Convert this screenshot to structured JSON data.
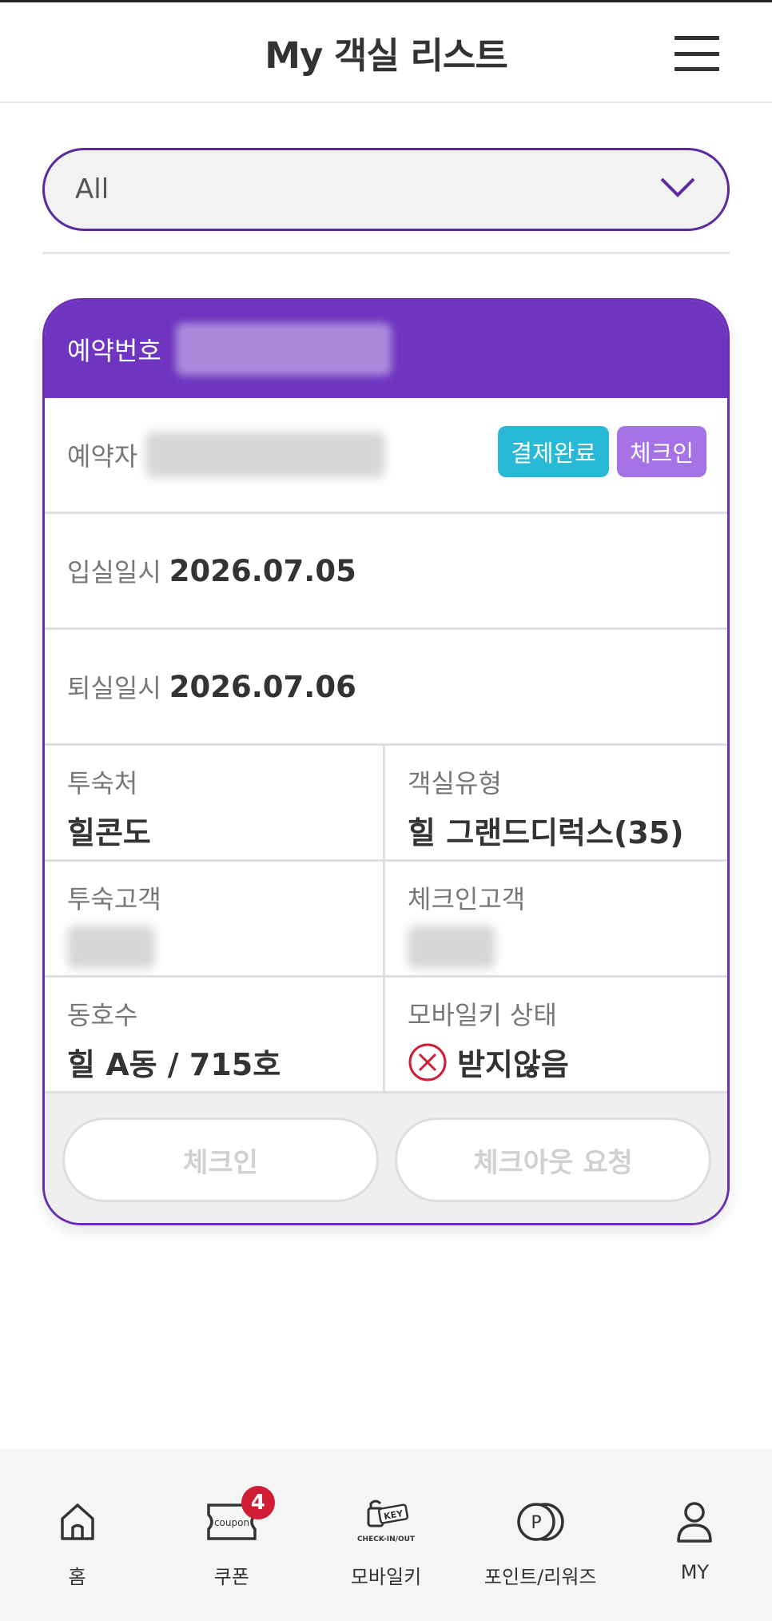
{
  "header": {
    "title": "My 객실 리스트"
  },
  "filter": {
    "selected": "All"
  },
  "reservation": {
    "number_label": "예약번호",
    "booker_label": "예약자",
    "badges": {
      "payment": "결제완료",
      "checkin": "체크인"
    },
    "checkin_date_label": "입실일시",
    "checkin_date": "2026.07.05",
    "checkout_date_label": "퇴실일시",
    "checkout_date": "2026.07.06",
    "property_label": "투숙처",
    "property": "힐콘도",
    "room_type_label": "객실유형",
    "room_type": "힐 그랜드디럭스(35)",
    "guest_label": "투숙고객",
    "checkin_guest_label": "체크인고객",
    "room_no_label": "동호수",
    "room_no": "힐 A동 / 715호",
    "mobile_key_label": "모바일키 상태",
    "mobile_key_status": "받지않음",
    "checkin_button": "체크인",
    "checkout_button": "체크아웃 요청"
  },
  "nav": {
    "home": "홈",
    "coupon": "쿠폰",
    "coupon_icon_text": "coupon",
    "coupon_count": "4",
    "mobile_key": "모바일키",
    "mobile_key_icon_text": "CHECK-IN/OUT",
    "key_icon_text": "KEY",
    "points": "포인트/리워즈",
    "points_icon_text": "P",
    "my": "MY"
  },
  "colors": {
    "accent": "#6f35c0",
    "paid": "#27b9d6",
    "checkin": "#a673e6",
    "alert": "#d01c34"
  }
}
